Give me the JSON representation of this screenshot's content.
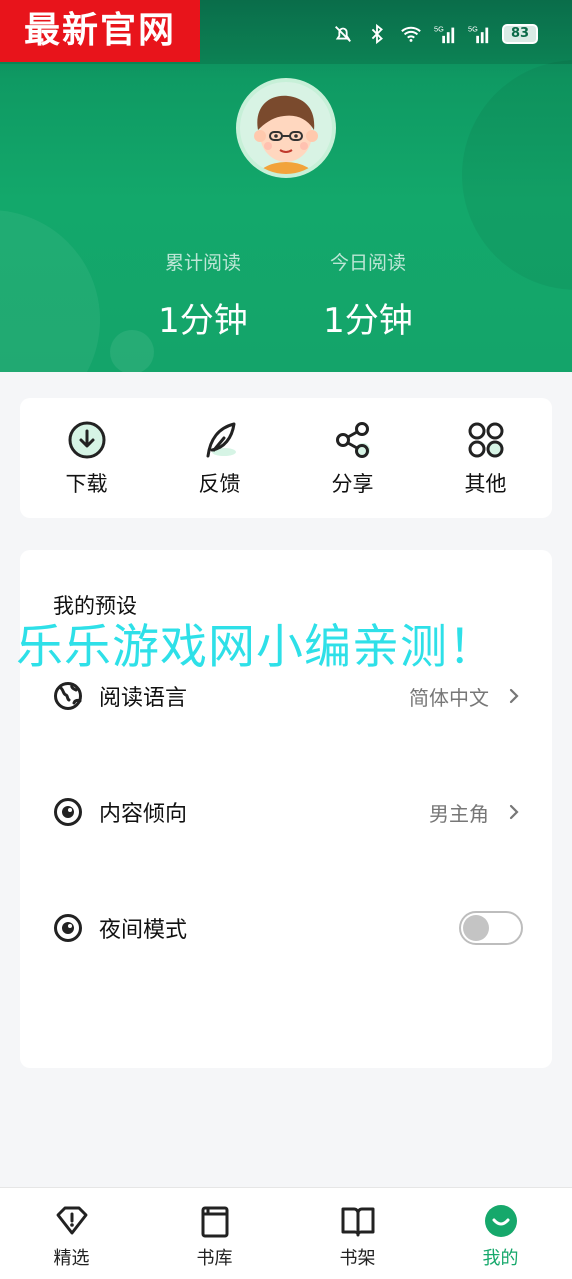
{
  "status_bar": {
    "brand_badge": "最新官网",
    "battery": "83",
    "signal_label": "5G"
  },
  "stats": [
    {
      "label": "累计阅读",
      "value": "1分钟"
    },
    {
      "label": "今日阅读",
      "value": "1分钟"
    }
  ],
  "quick_actions": [
    {
      "label": "下载",
      "icon": "download-icon"
    },
    {
      "label": "反馈",
      "icon": "feather-icon"
    },
    {
      "label": "分享",
      "icon": "share-icon"
    },
    {
      "label": "其他",
      "icon": "grid-icon"
    }
  ],
  "presets": {
    "title": "我的预设",
    "items": [
      {
        "label": "阅读语言",
        "value": "简体中文",
        "icon": "globe-icon"
      },
      {
        "label": "内容倾向",
        "value": "男主角",
        "icon": "eye-icon"
      },
      {
        "label": "夜间模式",
        "icon": "eye-icon",
        "toggle_on": false
      }
    ]
  },
  "watermark": "乐乐游戏网小编亲测！",
  "tabbar": {
    "items": [
      {
        "label": "精选",
        "icon": "diamond-icon",
        "active": false
      },
      {
        "label": "书库",
        "icon": "library-icon",
        "active": false
      },
      {
        "label": "书架",
        "icon": "book-icon",
        "active": false
      },
      {
        "label": "我的",
        "icon": "smile-icon",
        "active": true
      }
    ]
  },
  "colors": {
    "brand_green": "#13a86b",
    "badge_red": "#e8141b",
    "watermark_cyan": "#2ee0e8"
  }
}
